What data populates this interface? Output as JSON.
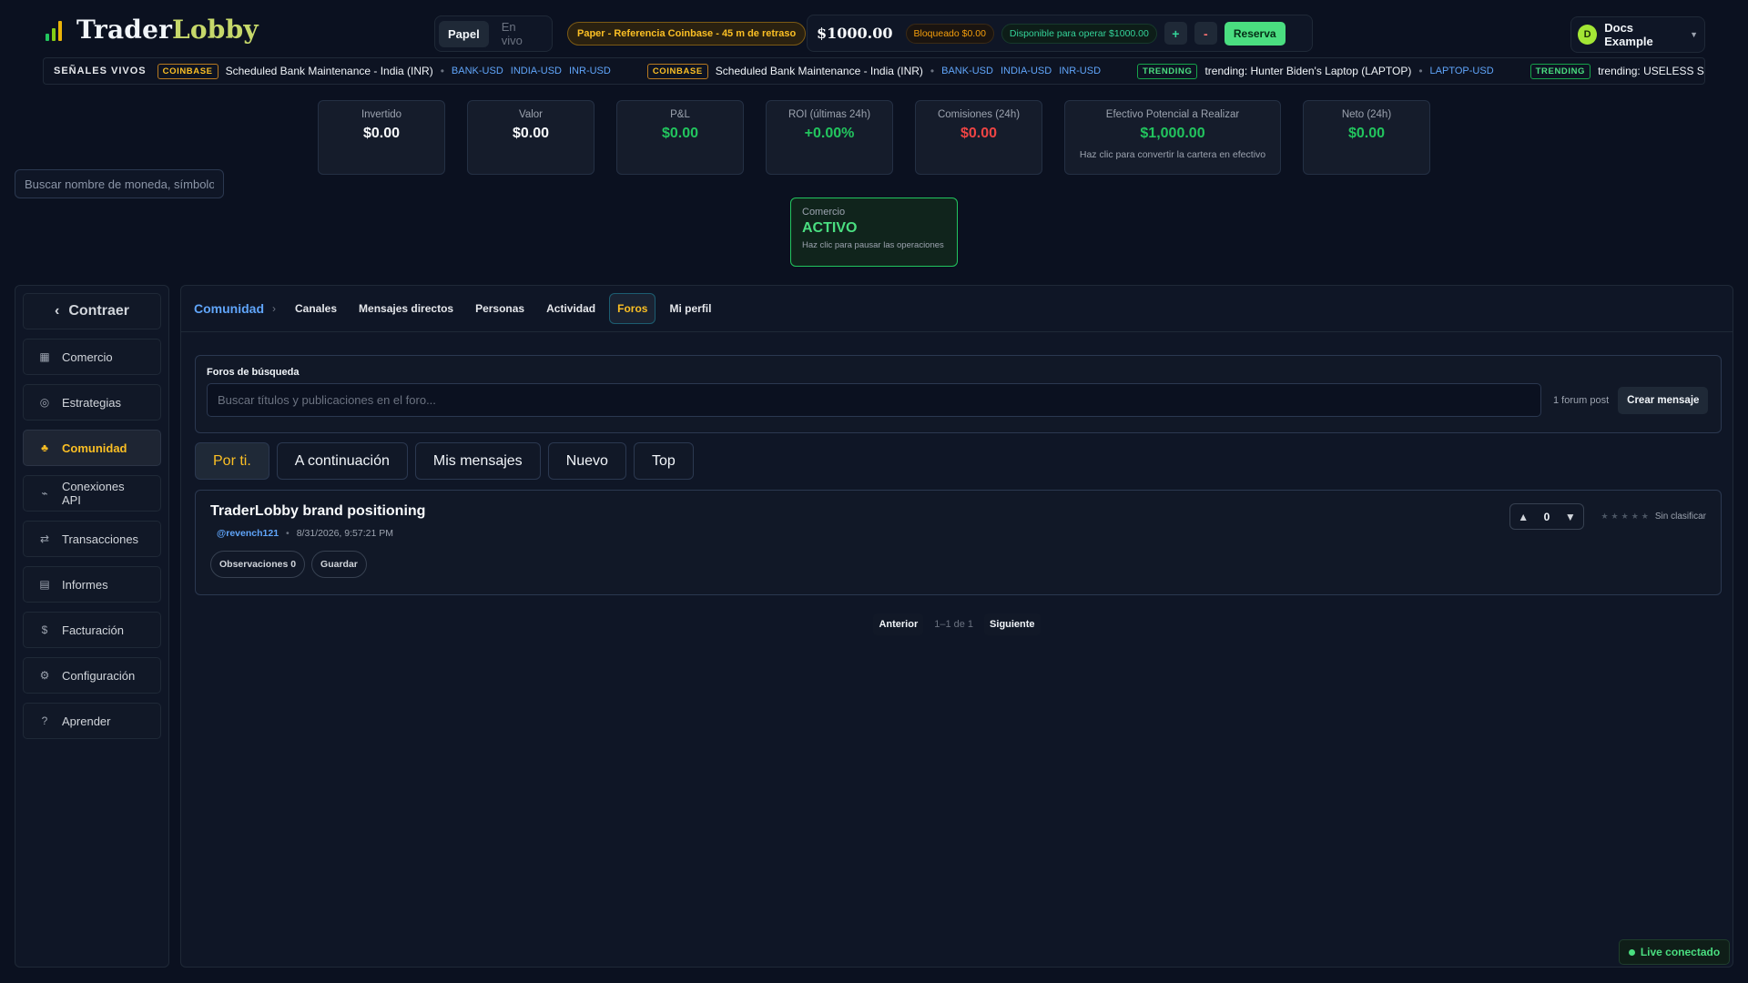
{
  "brand": {
    "name_part1": "Trader",
    "name_part2": "Lobby"
  },
  "header": {
    "mode_paper": "Papel",
    "mode_live": "En vivo",
    "paper_badge": "Paper - Referencia Coinbase - 45 m de retraso",
    "balance": "$1000.00",
    "blocked": "Bloqueado $0.00",
    "available": "Disponible para operar $1000.00",
    "plus_label": "+",
    "minus_label": "-",
    "reserve_label": "Reserva",
    "user_initial": "D",
    "user_name": "Docs Example"
  },
  "ticker": {
    "label": "SEÑALES VIVOS",
    "items": [
      {
        "source": "COINBASE",
        "title": "Scheduled Bank Maintenance - India (INR)",
        "symbols": [
          "BANK-USD",
          "INDIA-USD",
          "INR-USD"
        ]
      },
      {
        "source": "COINBASE",
        "title": "Scheduled Bank Maintenance - India (INR)",
        "symbols": [
          "BANK-USD",
          "INDIA-USD",
          "INR-USD"
        ]
      },
      {
        "source": "TRENDING",
        "title": "trending: Hunter Biden's Laptop (LAPTOP)",
        "symbols": [
          "LAPTOP-USD"
        ]
      },
      {
        "source": "TRENDING",
        "title": "trending: USELESS STONK (STON",
        "symbols": []
      }
    ]
  },
  "stats": [
    {
      "label": "Invertido",
      "value": "$0.00",
      "color": "#f8fafc",
      "hint": ""
    },
    {
      "label": "Valor",
      "value": "$0.00",
      "color": "#f8fafc",
      "hint": ""
    },
    {
      "label": "P&L",
      "value": "$0.00",
      "color": "#22c55e",
      "hint": ""
    },
    {
      "label": "ROI (últimas 24h)",
      "value": "+0.00%",
      "color": "#22c55e",
      "hint": ""
    },
    {
      "label": "Comisiones (24h)",
      "value": "$0.00",
      "color": "#ef4444",
      "hint": ""
    },
    {
      "label": "Efectivo Potencial a Realizar",
      "value": "$1,000.00",
      "color": "#22c55e",
      "hint": "Haz clic para convertir la cartera en efectivo"
    },
    {
      "label": "Neto (24h)",
      "value": "$0.00",
      "color": "#22c55e",
      "hint": ""
    }
  ],
  "coin_search": {
    "placeholder": "Buscar nombre de moneda, símbolo"
  },
  "trade": {
    "label": "Comercio",
    "status": "ACTIVO",
    "hint": "Haz clic para pausar las operaciones"
  },
  "sidebar": {
    "collapse_label": "Contraer",
    "items": [
      {
        "label": "Comercio",
        "icon": "grid-icon",
        "glyph": "▦",
        "active": false
      },
      {
        "label": "Estrategias",
        "icon": "target-icon",
        "glyph": "◎",
        "active": false
      },
      {
        "label": "Comunidad",
        "icon": "community-icon",
        "glyph": "♣",
        "active": true
      },
      {
        "label": "Conexiones API",
        "icon": "link-icon",
        "glyph": "⌁",
        "active": false
      },
      {
        "label": "Transacciones",
        "icon": "swap-icon",
        "glyph": "⇄",
        "active": false
      },
      {
        "label": "Informes",
        "icon": "report-icon",
        "glyph": "▤",
        "active": false
      },
      {
        "label": "Facturación",
        "icon": "dollar-icon",
        "glyph": "$",
        "active": false
      },
      {
        "label": "Configuración",
        "icon": "gear-icon",
        "glyph": "⚙",
        "active": false
      },
      {
        "label": "Aprender",
        "icon": "help-icon",
        "glyph": "?",
        "active": false
      }
    ]
  },
  "community": {
    "breadcrumb": "Comunidad",
    "tabs": [
      {
        "label": "Canales",
        "active": false
      },
      {
        "label": "Mensajes directos",
        "active": false
      },
      {
        "label": "Personas",
        "active": false
      },
      {
        "label": "Actividad",
        "active": false
      },
      {
        "label": "Foros",
        "active": true
      },
      {
        "label": "Mi perfil",
        "active": false
      }
    ],
    "search_label": "Foros de búsqueda",
    "search_placeholder": "Buscar títulos y publicaciones en el foro...",
    "post_count": "1 forum post",
    "create_label": "Crear mensaje",
    "filters": [
      {
        "label": "Por ti.",
        "active": true
      },
      {
        "label": "A continuación",
        "active": false
      },
      {
        "label": "Mis mensajes",
        "active": false
      },
      {
        "label": "Nuevo",
        "active": false
      },
      {
        "label": "Top",
        "active": false
      }
    ],
    "posts": [
      {
        "title": "TraderLobby brand positioning",
        "author": "@revench121",
        "date": "8/31/2026, 9:57:21 PM",
        "observations": "Observaciones 0",
        "save": "Guardar",
        "votes": "0",
        "rating_label": "Sin clasificar"
      }
    ],
    "pager": {
      "prev": "Anterior",
      "info": "1–1 de 1",
      "next": "Siguiente"
    }
  },
  "live_status": "Live conectado"
}
